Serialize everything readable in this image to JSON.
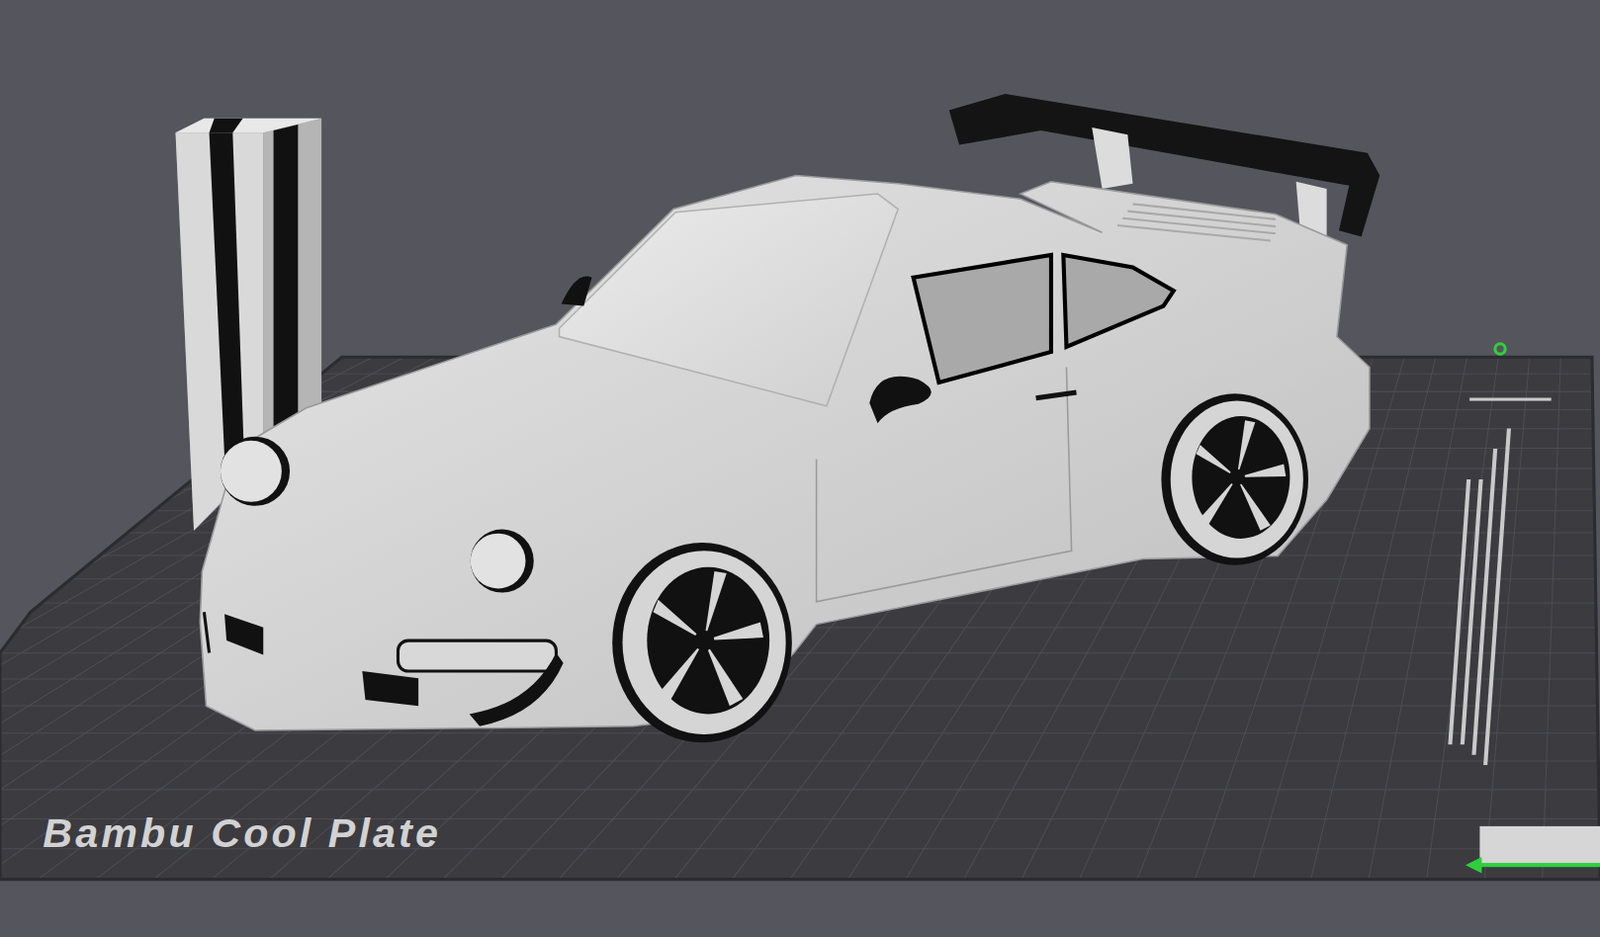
{
  "plate": {
    "label": "Bambu Cool Plate"
  }
}
